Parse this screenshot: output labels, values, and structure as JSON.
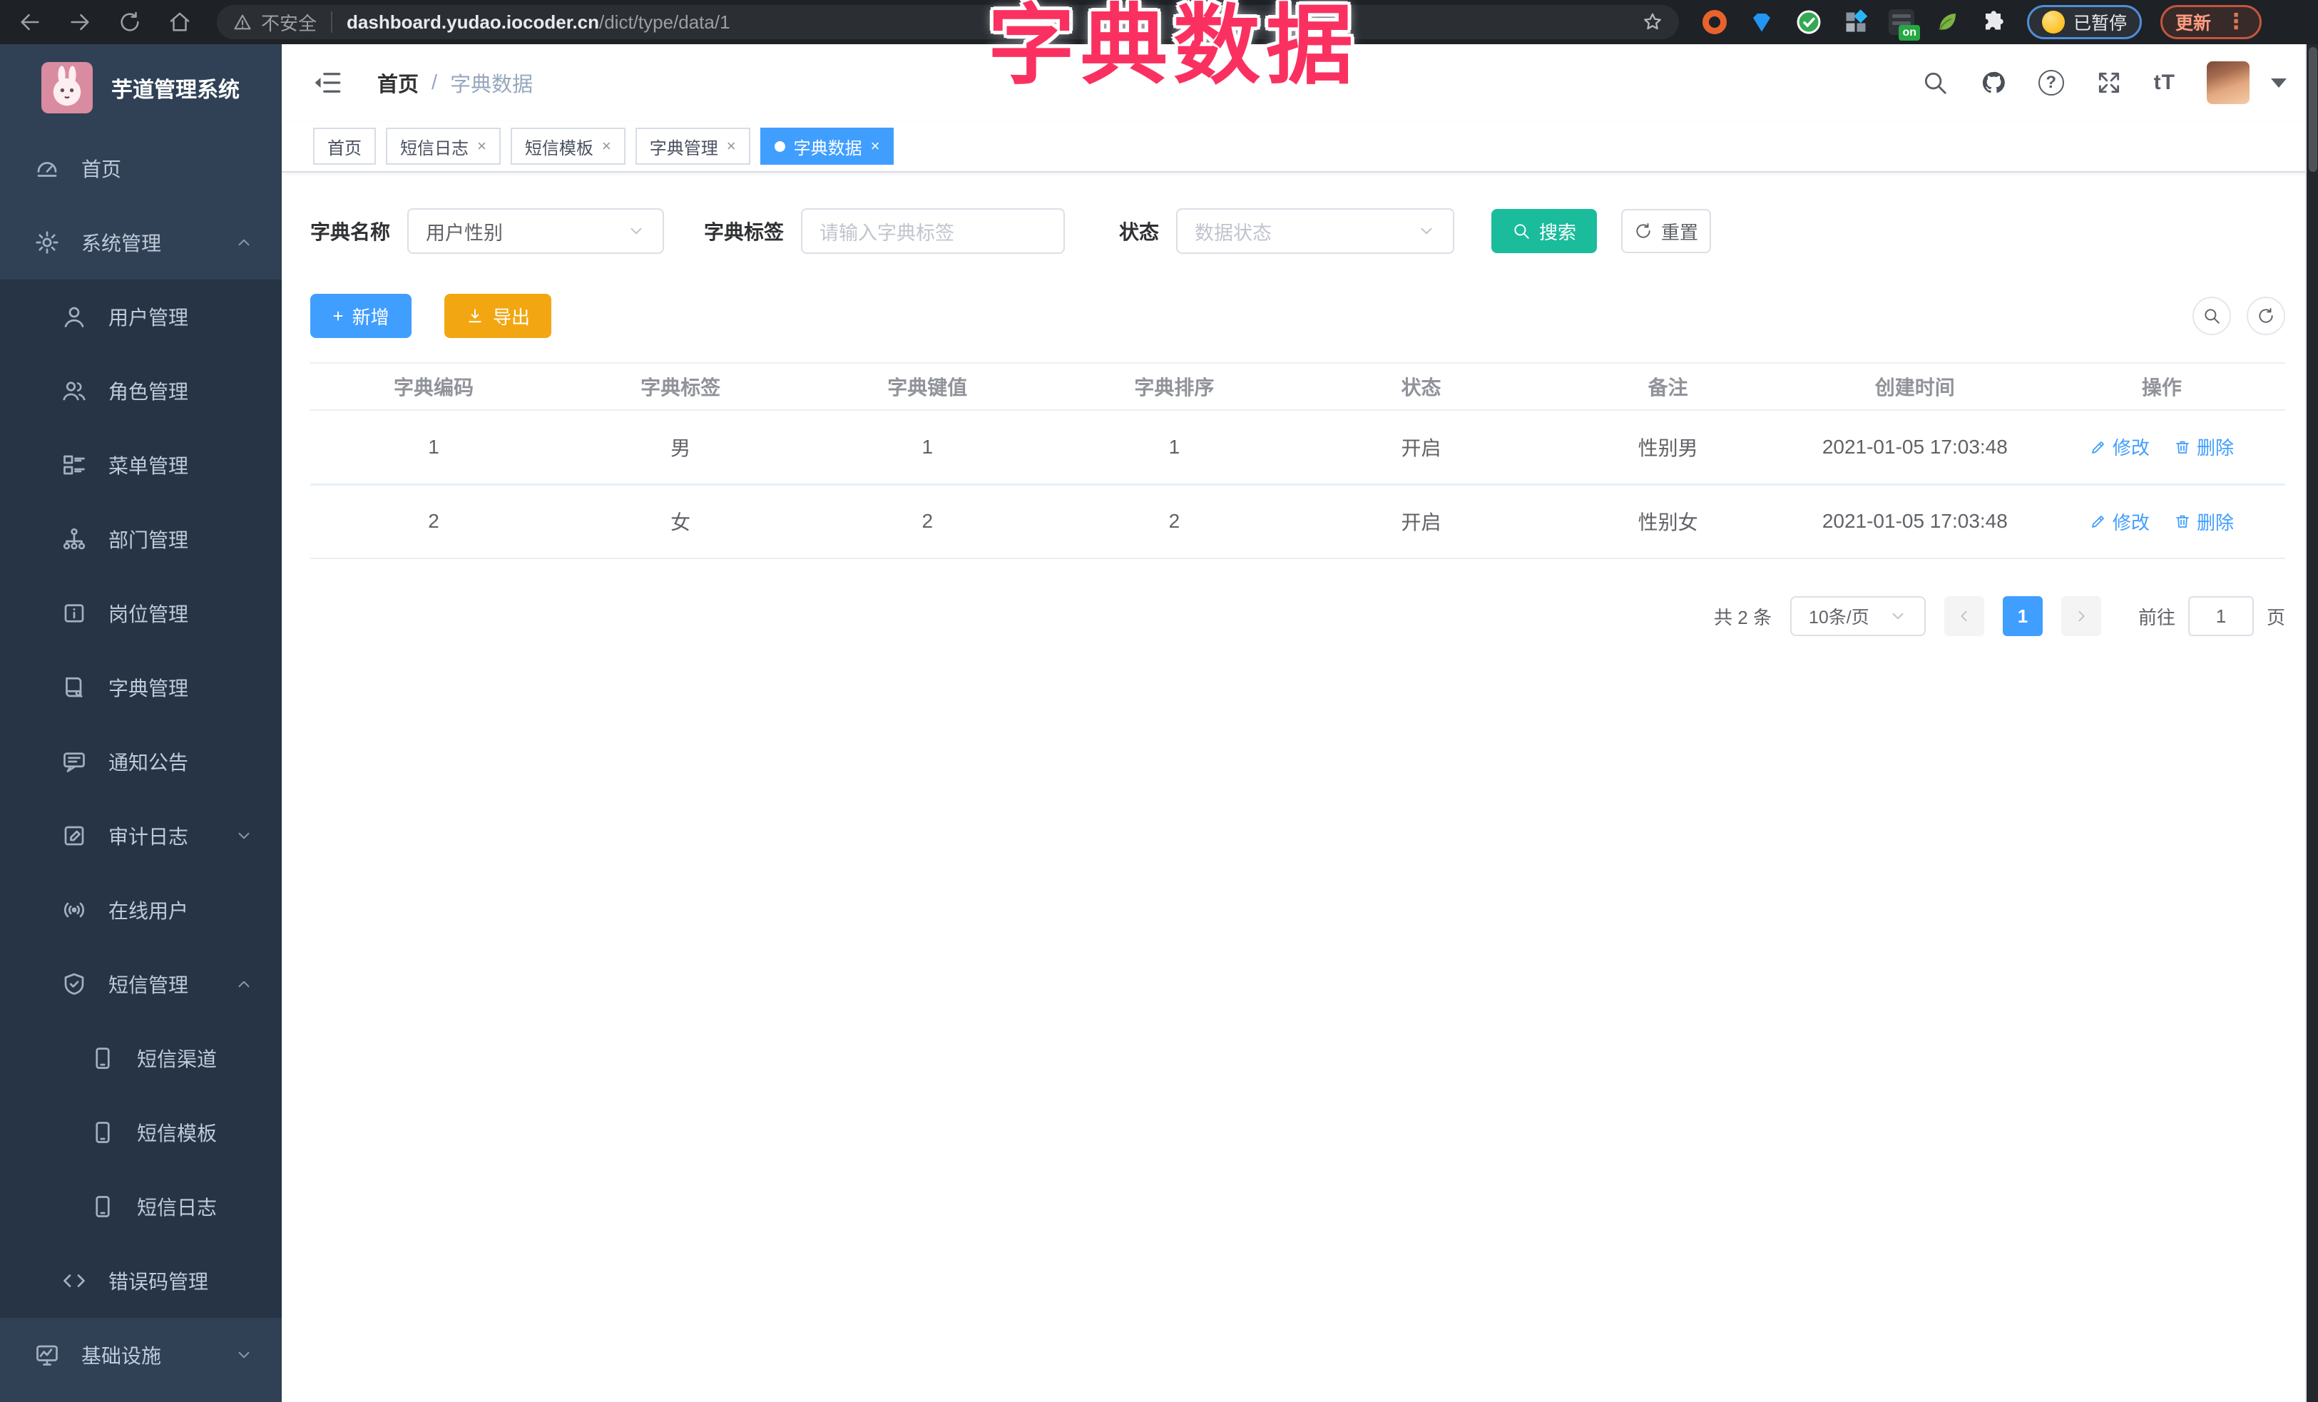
{
  "browser": {
    "security_label": "不安全",
    "url_domain": "dashboard.yudao.iocoder.cn",
    "url_path": "/dict/type/data/1",
    "paused_label": "已暂停",
    "update_label": "更新",
    "menu_dots": "⋮"
  },
  "overlay_title": "字典数据",
  "sidebar": {
    "app_title": "芋道管理系统",
    "items": [
      {
        "label": "首页"
      },
      {
        "label": "系统管理"
      },
      {
        "label": "用户管理"
      },
      {
        "label": "角色管理"
      },
      {
        "label": "菜单管理"
      },
      {
        "label": "部门管理"
      },
      {
        "label": "岗位管理"
      },
      {
        "label": "字典管理"
      },
      {
        "label": "通知公告"
      },
      {
        "label": "审计日志"
      },
      {
        "label": "在线用户"
      },
      {
        "label": "短信管理"
      },
      {
        "label": "短信渠道"
      },
      {
        "label": "短信模板"
      },
      {
        "label": "短信日志"
      },
      {
        "label": "错误码管理"
      },
      {
        "label": "基础设施"
      }
    ]
  },
  "header": {
    "breadcrumb_home": "首页",
    "breadcrumb_sep": "/",
    "breadcrumb_current": "字典数据",
    "text_size_label": "tT",
    "question_mark": "?"
  },
  "tabs": {
    "items": [
      {
        "label": "首页"
      },
      {
        "label": "短信日志"
      },
      {
        "label": "短信模板"
      },
      {
        "label": "字典管理"
      },
      {
        "label": "字典数据"
      }
    ],
    "close_glyph": "×"
  },
  "filter": {
    "dict_name_label": "字典名称",
    "dict_name_value": "用户性别",
    "dict_label_label": "字典标签",
    "dict_label_placeholder": "请输入字典标签",
    "status_label": "状态",
    "status_placeholder": "数据状态",
    "search_label": "搜索",
    "reset_label": "重置"
  },
  "toolbar": {
    "add_label": "新增",
    "add_glyph": "+",
    "export_label": "导出"
  },
  "table": {
    "columns": [
      "字典编码",
      "字典标签",
      "字典键值",
      "字典排序",
      "状态",
      "备注",
      "创建时间",
      "操作"
    ],
    "rows": [
      {
        "code": "1",
        "label": "男",
        "value": "1",
        "sort": "1",
        "status": "开启",
        "remark": "性别男",
        "created": "2021-01-05 17:03:48"
      },
      {
        "code": "2",
        "label": "女",
        "value": "2",
        "sort": "2",
        "status": "开启",
        "remark": "性别女",
        "created": "2021-01-05 17:03:48"
      }
    ],
    "edit_label": "修改",
    "delete_label": "删除"
  },
  "pagination": {
    "total_label": "共 2 条",
    "page_size_label": "10条/页",
    "current_page": "1",
    "goto_label": "前往",
    "goto_value": "1",
    "page_unit": "页"
  },
  "colors": {
    "accent_blue": "#409EFF",
    "search_teal": "#1ABC9C",
    "export_amber": "#F2A712",
    "overlay_pink": "#FA3160",
    "sidebar_bg": "#304156",
    "submenu_bg": "#263445"
  }
}
